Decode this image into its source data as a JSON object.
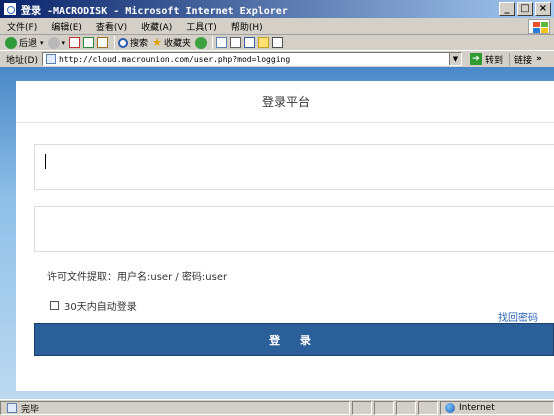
{
  "window": {
    "title": "登录 -MACRODISK - Microsoft Internet Explorer",
    "controls": [
      "_",
      "□",
      "×"
    ]
  },
  "menubar": {
    "items": [
      {
        "label": "文件(F)"
      },
      {
        "label": "编辑(E)"
      },
      {
        "label": "查看(V)"
      },
      {
        "label": "收藏(A)"
      },
      {
        "label": "工具(T)"
      },
      {
        "label": "帮助(H)"
      }
    ]
  },
  "toolbar": {
    "back_label": "后退",
    "search_label": "搜索",
    "favorites_label": "收藏夹"
  },
  "addressbar": {
    "label": "地址(D)",
    "url": "http://cloud.macrounion.com/user.php?mod=logging",
    "go_label": "转到",
    "links_label": "链接"
  },
  "page": {
    "header_title": "登录平台",
    "username_value": "",
    "password_value": "",
    "hint": "许可文件提取：用户名:user / 密码:user",
    "remember_label": "30天内自动登录",
    "forgot_label": "找回密码",
    "login_label": "登 录"
  },
  "statusbar": {
    "status_text": "完毕",
    "zone_text": "Internet"
  },
  "colors": {
    "login_button": "#2b5f9a",
    "forgot_link": "#2a64b8",
    "titlebar_start": "#0a246a"
  }
}
